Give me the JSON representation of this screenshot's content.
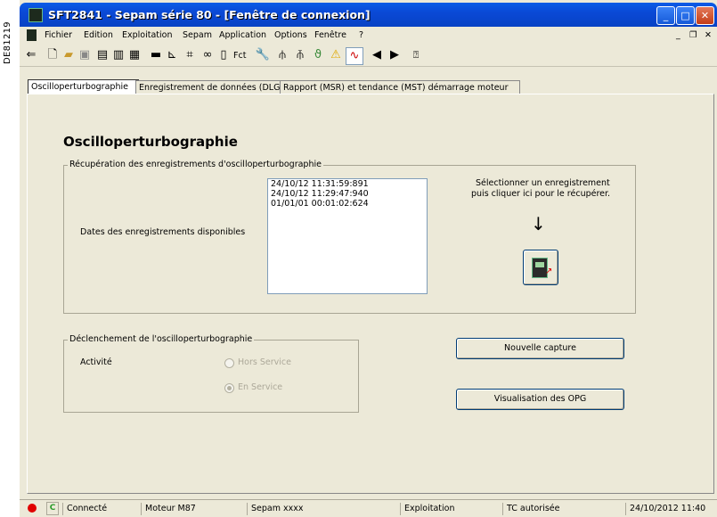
{
  "side_label": "DE81219",
  "window": {
    "title": "SFT2841 - Sepam série 80 - [Fenêtre de connexion]",
    "controls": {
      "minimize": "_",
      "maximize": "□",
      "close": "✕"
    }
  },
  "menu": [
    "Fichier",
    "Edition",
    "Exploitation",
    "Sepam",
    "Application",
    "Options",
    "Fenêtre",
    "?"
  ],
  "mdi_controls": {
    "minimize": "_",
    "restore": "❐",
    "close": "✕"
  },
  "toolbar": {
    "fct_label": "Fct",
    "icons": [
      "connect-icon",
      "new-file-icon",
      "open-folder-icon",
      "save-icon",
      "print-icon",
      "print-preview-icon",
      "print-setup-icon",
      "monitor-icon",
      "chart-icon",
      "network-icon",
      "relay-icon",
      "table-icon",
      "fct-icon",
      "wrench-icon",
      "diagram-icon",
      "tree-icon",
      "logic-icon",
      "warning-icon",
      "waveform-icon",
      "arrow-left-icon",
      "arrow-right-icon",
      "help-icon"
    ]
  },
  "tabs": [
    {
      "label": "Oscilloperturbographie",
      "active": true
    },
    {
      "label": "Enregistrement de données (DLG)",
      "active": false
    },
    {
      "label": "Rapport (MSR) et tendance (MST) démarrage moteur",
      "active": false
    }
  ],
  "main": {
    "heading": "Oscilloperturbographie",
    "retrieval": {
      "legend": "Récupération des enregistrements d'oscilloperturbographie",
      "dates_label": "Dates des enregistrements disponibles",
      "records": [
        "24/10/12  11:31:59:891",
        "24/10/12  11:29:47:940",
        "01/01/01  00:01:02:624"
      ],
      "hint_line1": "Sélectionner un enregistrement",
      "hint_line2": "puis cliquer ici pour le récupérer.",
      "arrow": "↓"
    },
    "trigger": {
      "legend": "Déclenchement de l'oscilloperturbographie",
      "activity_label": "Activité",
      "option_off": "Hors Service",
      "option_on": "En Service",
      "selected": "En Service"
    },
    "new_capture_button": "Nouvelle capture",
    "view_opg_button": "Visualisation des OPG"
  },
  "status": {
    "indicator_color": "#e00000",
    "connected_icon_label": "C",
    "connection": "Connecté",
    "model": "Moteur M87",
    "device": "Sepam xxxx",
    "mode": "Exploitation",
    "tc": "TC autorisée",
    "datetime": "24/10/2012 11:40"
  }
}
